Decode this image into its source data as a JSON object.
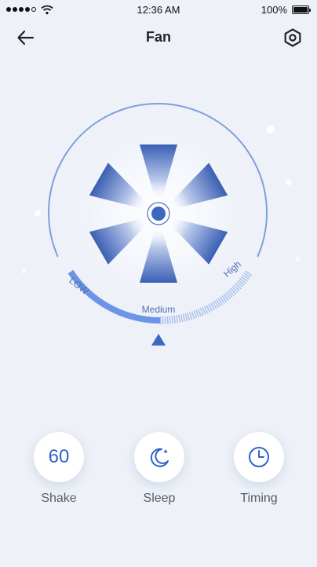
{
  "status_bar": {
    "time": "12:36 AM",
    "battery_percent": "100%",
    "signal_bars": 5,
    "signal_filled": 4
  },
  "nav": {
    "title": "Fan",
    "back_icon": "arrow-left-icon",
    "settings_icon": "hexagon-settings-icon"
  },
  "dial": {
    "speed_labels": [
      "LOW",
      "Medium",
      "High"
    ],
    "current_speed": "Medium",
    "accent_color": "#3c68c2",
    "arc_color": "#7e9fdc"
  },
  "controls": [
    {
      "value": "60",
      "label": "Shake"
    },
    {
      "icon": "moon-star-icon",
      "label": "Sleep"
    },
    {
      "icon": "clock-icon",
      "label": "Timing"
    }
  ]
}
